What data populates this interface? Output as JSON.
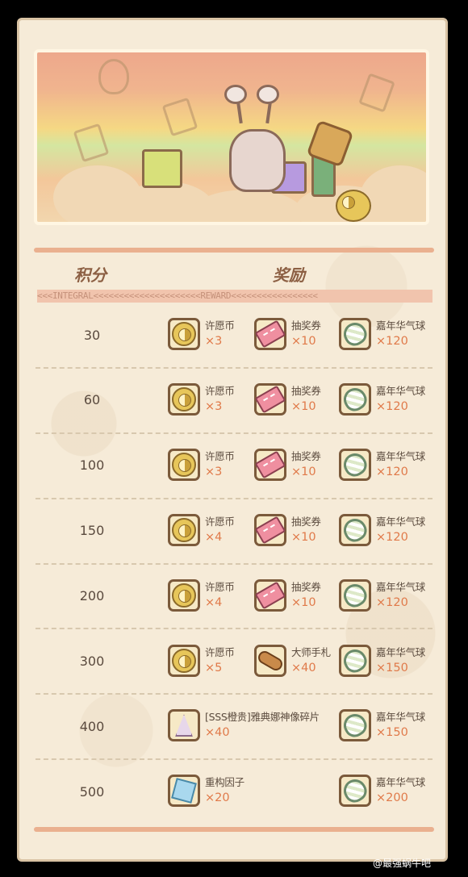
{
  "header": {
    "score_label": "积分",
    "reward_label": "奖励",
    "strip_text": "<<<INTEGRAL<<<<<<<<<<<<<<<<<<<<<REWARD<<<<<<<<<<<<<<<<<"
  },
  "rows": [
    {
      "score": "30",
      "items": [
        {
          "name": "许愿币",
          "qty": "×3",
          "icon": "wish-coin-icon"
        },
        {
          "name": "抽奖券",
          "qty": "×10",
          "icon": "lottery-ticket-icon"
        },
        {
          "name": "嘉年华气球",
          "qty": "×120",
          "icon": "carnival-balloon-icon"
        }
      ]
    },
    {
      "score": "60",
      "items": [
        {
          "name": "许愿币",
          "qty": "×3",
          "icon": "wish-coin-icon"
        },
        {
          "name": "抽奖券",
          "qty": "×10",
          "icon": "lottery-ticket-icon"
        },
        {
          "name": "嘉年华气球",
          "qty": "×120",
          "icon": "carnival-balloon-icon"
        }
      ]
    },
    {
      "score": "100",
      "items": [
        {
          "name": "许愿币",
          "qty": "×3",
          "icon": "wish-coin-icon"
        },
        {
          "name": "抽奖券",
          "qty": "×10",
          "icon": "lottery-ticket-icon"
        },
        {
          "name": "嘉年华气球",
          "qty": "×120",
          "icon": "carnival-balloon-icon"
        }
      ]
    },
    {
      "score": "150",
      "items": [
        {
          "name": "许愿币",
          "qty": "×4",
          "icon": "wish-coin-icon"
        },
        {
          "name": "抽奖券",
          "qty": "×10",
          "icon": "lottery-ticket-icon"
        },
        {
          "name": "嘉年华气球",
          "qty": "×120",
          "icon": "carnival-balloon-icon"
        }
      ]
    },
    {
      "score": "200",
      "items": [
        {
          "name": "许愿币",
          "qty": "×4",
          "icon": "wish-coin-icon"
        },
        {
          "name": "抽奖券",
          "qty": "×10",
          "icon": "lottery-ticket-icon"
        },
        {
          "name": "嘉年华气球",
          "qty": "×120",
          "icon": "carnival-balloon-icon"
        }
      ]
    },
    {
      "score": "300",
      "items": [
        {
          "name": "许愿币",
          "qty": "×5",
          "icon": "wish-coin-icon"
        },
        {
          "name": "大师手札",
          "qty": "×40",
          "icon": "master-scroll-icon"
        },
        {
          "name": "嘉年华气球",
          "qty": "×150",
          "icon": "carnival-balloon-icon"
        }
      ]
    },
    {
      "score": "400",
      "items": [
        {
          "name": "[SSS橙贵]雅典娜神像碎片",
          "qty": "×40",
          "icon": "athena-statue-shard-icon"
        },
        {
          "name": "嘉年华气球",
          "qty": "×150",
          "icon": "carnival-balloon-icon"
        }
      ]
    },
    {
      "score": "500",
      "items": [
        {
          "name": "重构因子",
          "qty": "×20",
          "icon": "reconstruct-factor-icon"
        },
        {
          "name": "嘉年华气球",
          "qty": "×200",
          "icon": "carnival-balloon-icon"
        }
      ]
    }
  ],
  "watermark": "@最强蜗牛吧"
}
